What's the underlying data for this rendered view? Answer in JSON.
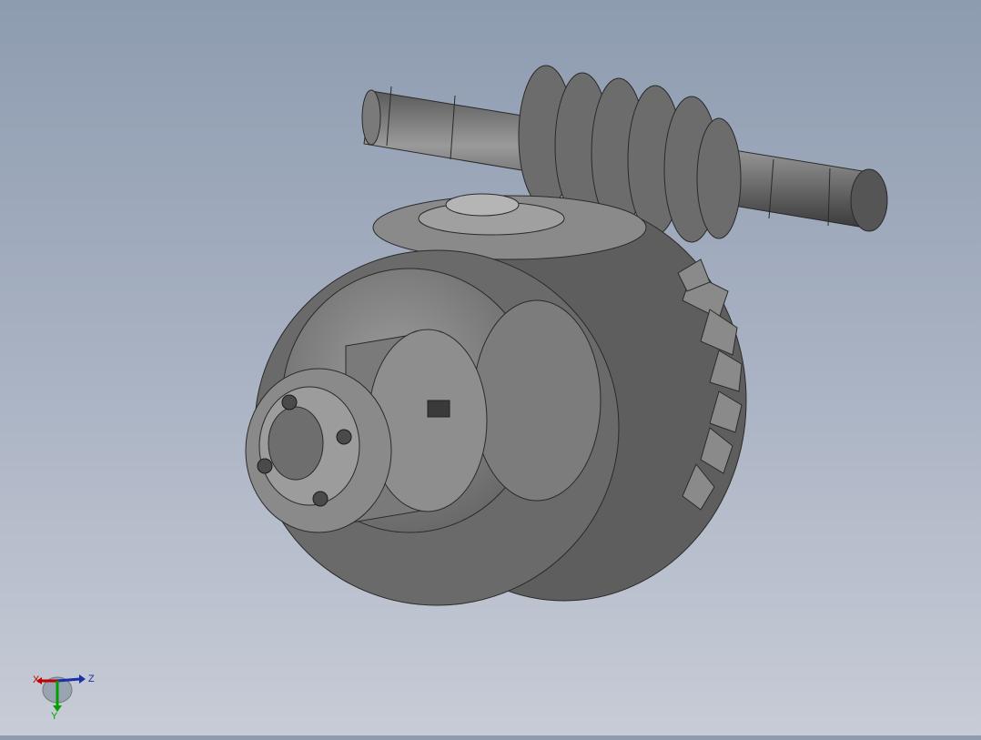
{
  "viewport": {
    "background_top": "#8e9cb0",
    "background_bottom": "#c7ccd6",
    "model": "worm-and-bevel-gear-assembly"
  },
  "triad": {
    "x_label": "X",
    "y_label": "Y",
    "z_label": "Z",
    "x_color": "#c00000",
    "y_color": "#00a000",
    "z_color": "#1a2fa8"
  }
}
